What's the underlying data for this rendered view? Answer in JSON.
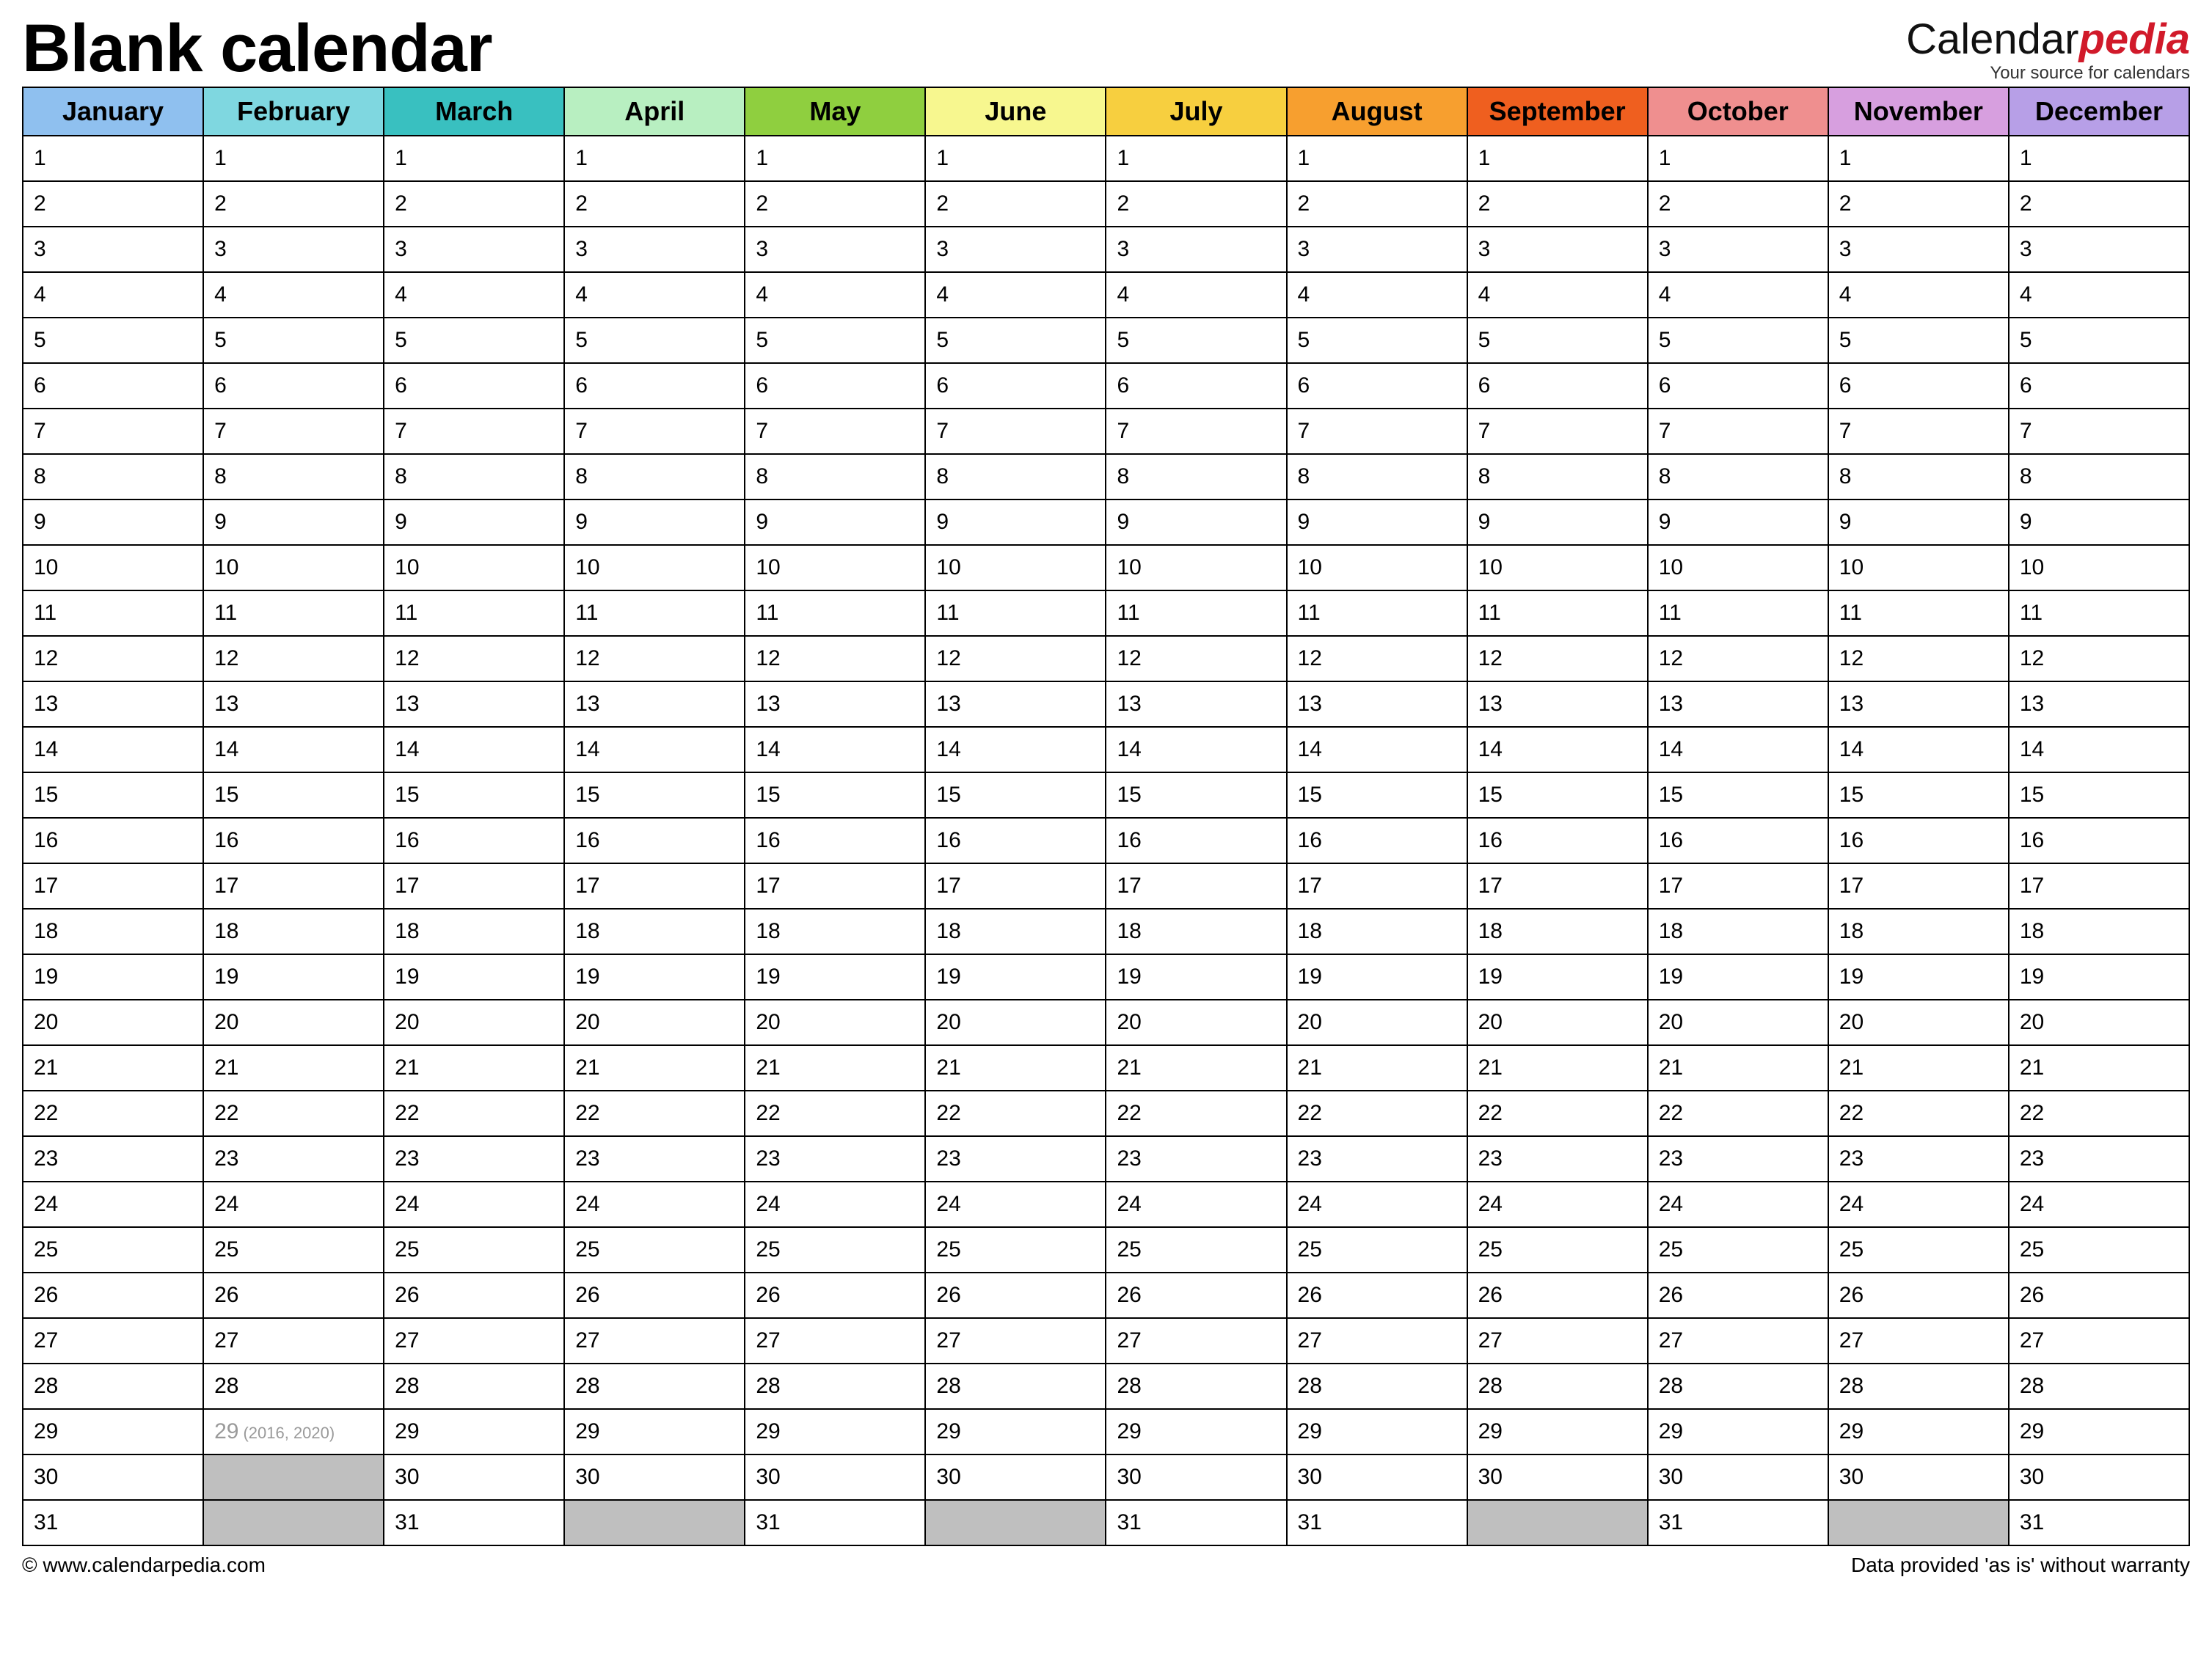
{
  "title": "Blank calendar",
  "brand": {
    "prefix": "Calendar",
    "suffix": "pedia",
    "tagline": "Your source for calendars"
  },
  "footer": {
    "left": "© www.calendarpedia.com",
    "right": "Data provided 'as is' without warranty"
  },
  "months": [
    {
      "name": "January",
      "color": "#8fc0ef",
      "days": 31
    },
    {
      "name": "February",
      "color": "#7fd7e0",
      "days": 29,
      "leap_day": 29,
      "leap_note": "(2016, 2020)"
    },
    {
      "name": "March",
      "color": "#39c0c0",
      "days": 31
    },
    {
      "name": "April",
      "color": "#b8efc1",
      "days": 30
    },
    {
      "name": "May",
      "color": "#8fcf3f",
      "days": 31
    },
    {
      "name": "June",
      "color": "#f7f78f",
      "days": 30
    },
    {
      "name": "July",
      "color": "#f7cf3f",
      "days": 31
    },
    {
      "name": "August",
      "color": "#f79f2f",
      "days": 31
    },
    {
      "name": "September",
      "color": "#ef5f1f",
      "days": 30
    },
    {
      "name": "October",
      "color": "#ef8f8f",
      "days": 31
    },
    {
      "name": "November",
      "color": "#d79fdf",
      "days": 30
    },
    {
      "name": "December",
      "color": "#b79fe7",
      "days": 31
    }
  ],
  "max_rows": 31
}
